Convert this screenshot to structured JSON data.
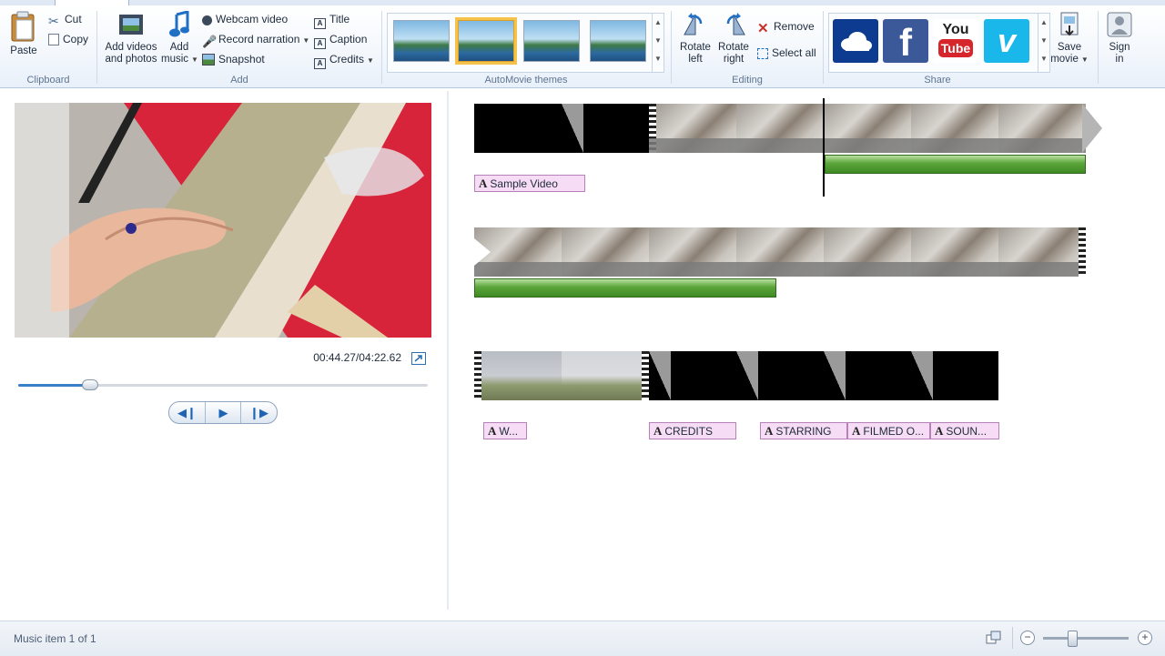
{
  "ribbon": {
    "clipboard": {
      "label": "Clipboard",
      "paste": "Paste",
      "cut": "Cut",
      "copy": "Copy"
    },
    "add": {
      "label": "Add",
      "add_videos": "Add videos",
      "add_videos_2": "and photos",
      "add_music": "Add",
      "add_music_2": "music",
      "webcam_video": "Webcam video",
      "record_narration": "Record narration",
      "snapshot": "Snapshot",
      "title": "Title",
      "caption": "Caption",
      "credits": "Credits"
    },
    "automovie": {
      "label": "AutoMovie themes"
    },
    "editing": {
      "label": "Editing",
      "rotate_left": "Rotate",
      "rotate_left_2": "left",
      "rotate_right": "Rotate",
      "rotate_right_2": "right",
      "remove": "Remove",
      "select_all": "Select all"
    },
    "share": {
      "label": "Share",
      "save_movie": "Save",
      "save_movie_2": "movie",
      "sign_in": "Sign",
      "sign_in_2": "in",
      "services": [
        "onedrive-icon",
        "facebook-icon",
        "youtube-icon",
        "vimeo-icon"
      ]
    }
  },
  "player": {
    "timecode": "00:44.27/04:22.62",
    "progress_fraction": 0.174
  },
  "storyboard": {
    "captions_row1": [
      "Sample Video"
    ],
    "captions_row3": [
      "W...",
      "CREDITS",
      "STARRING",
      "FILMED O...",
      "SOUN..."
    ]
  },
  "status": {
    "text": "Music item 1 of 1",
    "zoom_fraction": 0.33
  },
  "colors": {
    "accent": "#3a80c9",
    "caption_bg": "#f7dcf5",
    "audio_green": "#5aa43a",
    "selected_theme": "#f5c24a"
  }
}
